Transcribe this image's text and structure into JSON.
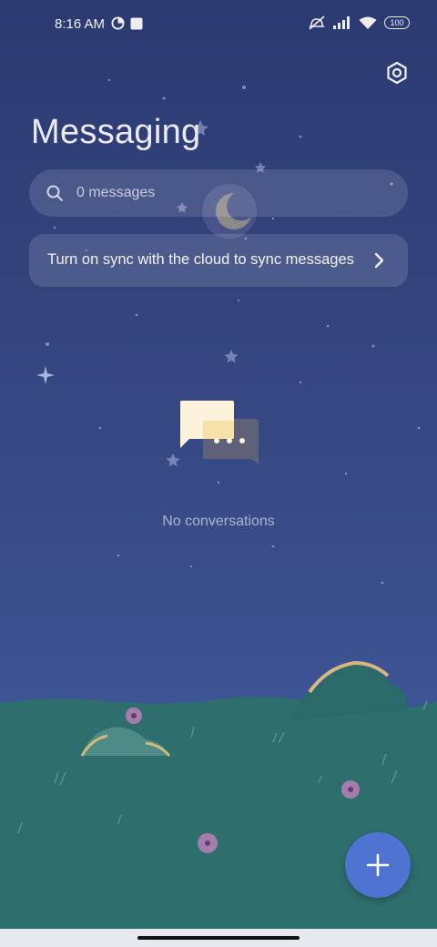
{
  "status_bar": {
    "time": "8:16 AM",
    "battery": "100",
    "left_icons": [
      "data-saver-icon",
      "notification-square-icon"
    ],
    "right_icons": [
      "mute-icon",
      "signal-icon",
      "wifi-icon",
      "battery-icon"
    ]
  },
  "header": {
    "title": "Messaging",
    "settings_icon": "settings-hexagon-icon"
  },
  "search": {
    "placeholder": "0 messages",
    "icon": "search-icon"
  },
  "sync_banner": {
    "text": "Turn on sync with the cloud to sync messages",
    "icon": "chevron-right-icon"
  },
  "empty_state": {
    "icon": "chat-bubbles-icon",
    "label": "No conversations"
  },
  "fab": {
    "icon": "plus-icon"
  },
  "colors": {
    "sky": "#2c3a72",
    "grass": "#2d6e6c",
    "fab": "#4f73d1",
    "card": "rgba(255,255,255,0.13)"
  }
}
